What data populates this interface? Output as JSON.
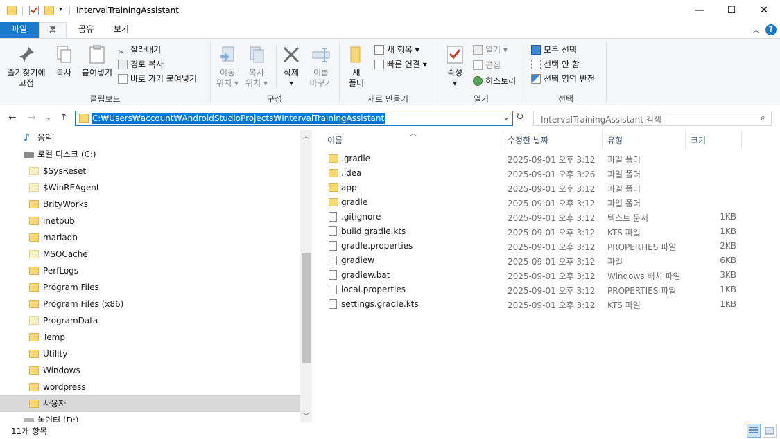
{
  "window": {
    "title": "IntervalTrainingAssistant",
    "minimize_glyph": "—",
    "maximize_glyph": "☐",
    "close_glyph": "✕"
  },
  "ribbon_tabs": [
    "파일",
    "홈",
    "공유",
    "보기"
  ],
  "ribbon": {
    "clipboard": {
      "pin_label_1": "즐겨찾기에",
      "pin_label_2": "고정",
      "copy": "복사",
      "paste": "붙여넣기",
      "cut": "잘라내기",
      "copy_path": "경로 복사",
      "paste_shortcut": "바로 가기 붙여넣기",
      "group": "클립보드"
    },
    "organize": {
      "move_1": "이동",
      "move_2": "위치",
      "copy_1": "복사",
      "copy_2": "위치",
      "delete": "삭제",
      "rename_1": "이름",
      "rename_2": "바꾸기",
      "group": "구성"
    },
    "new": {
      "folder_1": "새",
      "folder_2": "폴더",
      "new_item": "새 항목",
      "easy_access": "빠른 연결",
      "group": "새로 만들기"
    },
    "open": {
      "properties": "속성",
      "open": "열기",
      "edit": "편집",
      "history": "히스토리",
      "group": "열기"
    },
    "select": {
      "select_all": "모두 선택",
      "select_none": "선택 안 함",
      "invert": "선택 영역 반전",
      "group": "선택"
    }
  },
  "address": {
    "path": "C:₩Users₩account₩AndroidStudioProjects₩IntervalTrainingAssistant",
    "search_placeholder": "IntervalTrainingAssistant 검색"
  },
  "nav_pane": {
    "music": "음악",
    "local_disk": "로컬 디스크 (C:)",
    "folders": [
      {
        "name": "$SysReset",
        "pale": true
      },
      {
        "name": "$WinREAgent",
        "pale": true
      },
      {
        "name": "BrityWorks",
        "pale": false
      },
      {
        "name": "inetpub",
        "pale": false
      },
      {
        "name": "mariadb",
        "pale": false
      },
      {
        "name": "MSOCache",
        "pale": true
      },
      {
        "name": "PerfLogs",
        "pale": false
      },
      {
        "name": "Program Files",
        "pale": false
      },
      {
        "name": "Program Files (x86)",
        "pale": false
      },
      {
        "name": "ProgramData",
        "pale": true
      },
      {
        "name": "Temp",
        "pale": false
      },
      {
        "name": "Utility",
        "pale": false
      },
      {
        "name": "Windows",
        "pale": false
      },
      {
        "name": "wordpress",
        "pale": false
      },
      {
        "name": "사용자",
        "pale": false
      }
    ],
    "next_drive": "놓인터 (D:)"
  },
  "file_list": {
    "columns": [
      "이름",
      "수정한 날짜",
      "유형",
      "크기"
    ],
    "rows": [
      {
        "name": ".gradle",
        "date": "2025-09-01 오후 3:12",
        "type": "파일 폴더",
        "size": "",
        "kind": "folder"
      },
      {
        "name": ".idea",
        "date": "2025-09-01 오후 3:26",
        "type": "파일 폴더",
        "size": "",
        "kind": "folder"
      },
      {
        "name": "app",
        "date": "2025-09-01 오후 3:12",
        "type": "파일 폴더",
        "size": "",
        "kind": "folder"
      },
      {
        "name": "gradle",
        "date": "2025-09-01 오후 3:12",
        "type": "파일 폴더",
        "size": "",
        "kind": "folder"
      },
      {
        "name": ".gitignore",
        "date": "2025-09-01 오후 3:12",
        "type": "텍스트 문서",
        "size": "1KB",
        "kind": "file"
      },
      {
        "name": "build.gradle.kts",
        "date": "2025-09-01 오후 3:12",
        "type": "KTS 파일",
        "size": "1KB",
        "kind": "file"
      },
      {
        "name": "gradle.properties",
        "date": "2025-09-01 오후 3:12",
        "type": "PROPERTIES 파일",
        "size": "2KB",
        "kind": "file"
      },
      {
        "name": "gradlew",
        "date": "2025-09-01 오후 3:12",
        "type": "파일",
        "size": "6KB",
        "kind": "file"
      },
      {
        "name": "gradlew.bat",
        "date": "2025-09-01 오후 3:12",
        "type": "Windows 배치 파일",
        "size": "3KB",
        "kind": "file"
      },
      {
        "name": "local.properties",
        "date": "2025-09-01 오후 3:12",
        "type": "PROPERTIES 파일",
        "size": "1KB",
        "kind": "file"
      },
      {
        "name": "settings.gradle.kts",
        "date": "2025-09-01 오후 3:12",
        "type": "KTS 파일",
        "size": "1KB",
        "kind": "file"
      }
    ]
  },
  "status": {
    "item_count": "11개 항목"
  },
  "colors": {
    "accent": "#1979ca",
    "selection": "#0078d7",
    "folder": "#f8d775"
  }
}
